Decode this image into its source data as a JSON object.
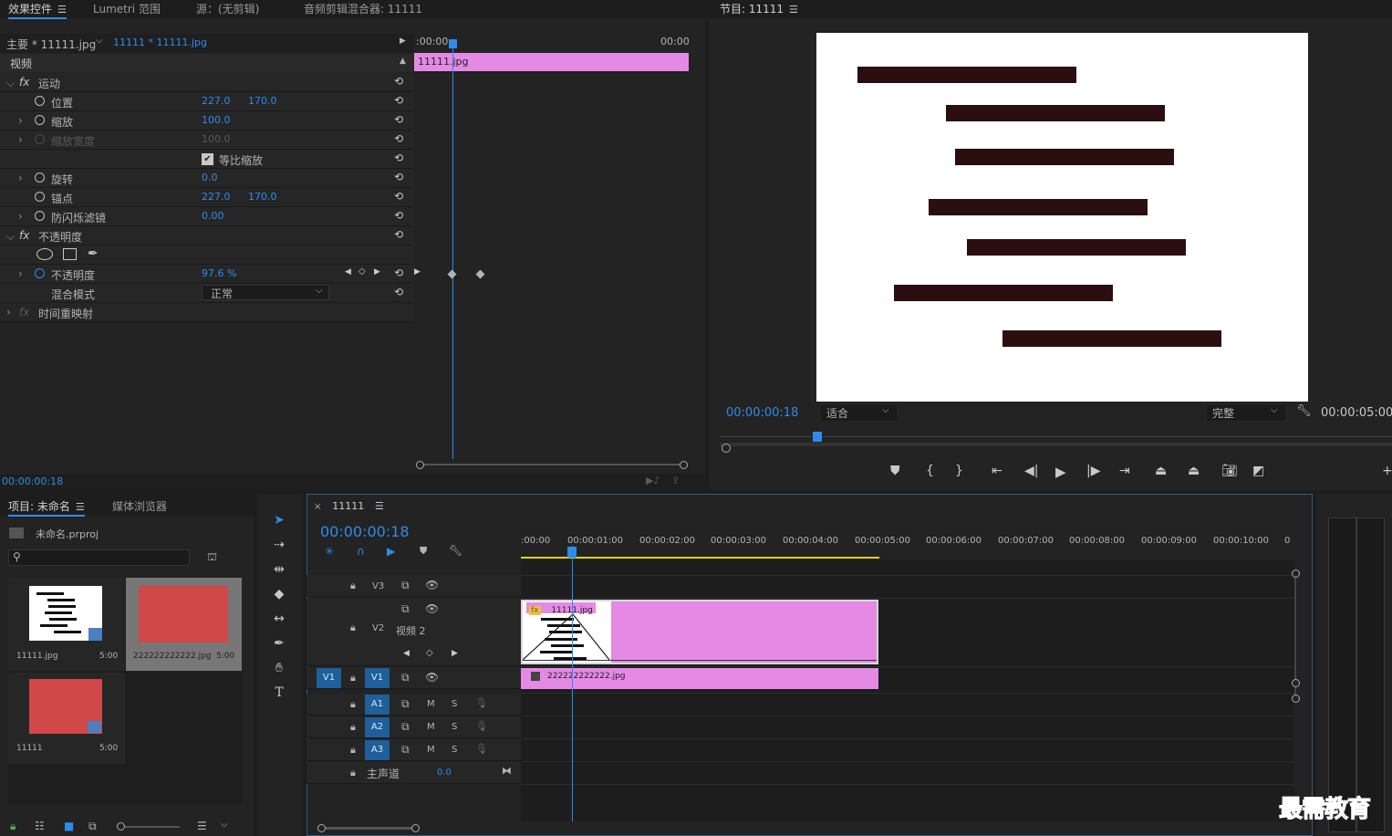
{
  "effect_controls": {
    "tabs": [
      "效果控件",
      "Lumetri 范围",
      "源：(无剪辑)",
      "音频剪辑混合器: 11111"
    ],
    "master_clip": "主要 * 11111.jpg",
    "seq_clip": "11111 * 11111.jpg",
    "timecode_start": ":00:00",
    "timecode_end": "00:00",
    "clip_bar_label": "11111.jpg",
    "section_video": "视频",
    "motion": "运动",
    "position_label": "位置",
    "position_x": "227.0",
    "position_y": "170.0",
    "scale_label": "缩放",
    "scale_value": "100.0",
    "scale_width_label": "缩放宽度",
    "scale_width_value": "100.0",
    "uniform_scale_label": "等比缩放",
    "rotation_label": "旋转",
    "rotation_value": "0.0",
    "anchor_label": "锚点",
    "anchor_x": "227.0",
    "anchor_y": "170.0",
    "antiflicker_label": "防闪烁滤镜",
    "antiflicker_value": "0.00",
    "opacity_group": "不透明度",
    "opacity_label": "不透明度",
    "opacity_value": "97.6 %",
    "blend_label": "混合模式",
    "blend_value": "正常",
    "time_remap": "时间重映射",
    "footer_timecode": "00:00:00:18"
  },
  "program": {
    "title": "节目: 11111",
    "timecode": "00:00:00:18",
    "fit": "适合",
    "quality": "完整",
    "duration": "00:00:05:00"
  },
  "project": {
    "tabs": [
      "项目: 未命名",
      "媒体浏览器"
    ],
    "file": "未命名.prproj",
    "items": [
      {
        "name": "11111.jpg",
        "dur": "5:00"
      },
      {
        "name": "222222222222.jpg",
        "dur": "5:00"
      },
      {
        "name": "11111",
        "dur": "5:00"
      }
    ]
  },
  "timeline": {
    "tab": "11111",
    "timecode": "00:00:00:18",
    "ruler": [
      ":00:00",
      "00:00:01:00",
      "00:00:02:00",
      "00:00:03:00",
      "00:00:04:00",
      "00:00:05:00",
      "00:00:06:00",
      "00:00:07:00",
      "00:00:08:00",
      "00:00:09:00",
      "00:00:10:00",
      "0"
    ],
    "tracks": {
      "v3": "V3",
      "v2": "V2",
      "v2_name": "视频 2",
      "v1": "V1",
      "v1_src": "V1",
      "a1": "A1",
      "a2": "A2",
      "a3": "A3",
      "m": "M",
      "s": "S",
      "master": "主声道",
      "master_value": "0.0"
    },
    "clip_v2": "11111.jpg",
    "clip_v1": "222222222222.jpg"
  },
  "watermark": "最需教育",
  "colors": {
    "accent": "#2d8ceb",
    "clip": "#e48ae4",
    "red_thumb": "#d04848",
    "bars": "#2b0e10"
  }
}
